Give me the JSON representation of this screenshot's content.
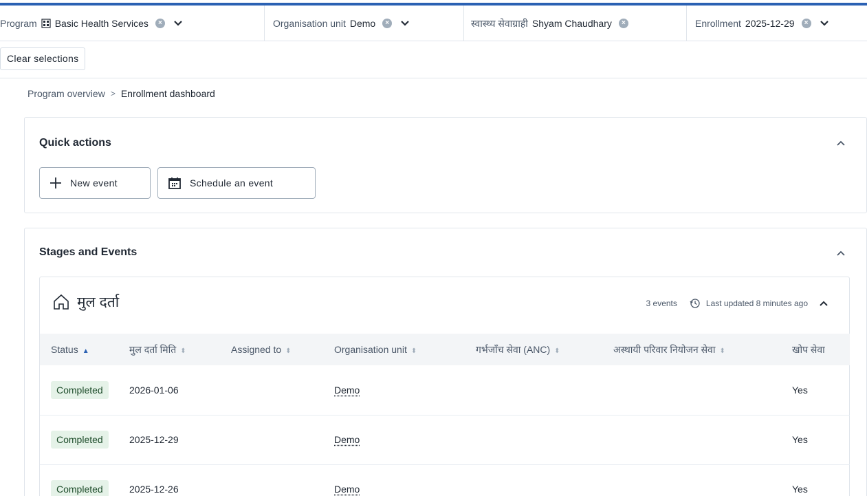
{
  "selection_bar": {
    "program_label": "Program",
    "program_value": "Basic Health Services",
    "orgunit_label": "Organisation unit",
    "orgunit_value": "Demo",
    "person_label": "स्वास्थ्य सेवाग्राही",
    "person_value": "Shyam Chaudhary",
    "enrollment_label": "Enrollment",
    "enrollment_value": "2025-12-29",
    "clear_label": "Clear selections"
  },
  "breadcrumb": {
    "parent": "Program overview",
    "separator": ">",
    "current": "Enrollment dashboard"
  },
  "quick_actions": {
    "title": "Quick actions",
    "new_event_label": "New event",
    "schedule_label": "Schedule an event"
  },
  "stages": {
    "title": "Stages and Events",
    "stage_name": "मुल दर्ता",
    "events_count": "3 events",
    "last_updated": "Last updated 8 minutes ago",
    "columns": [
      "Status",
      "मुल दर्ता मिति",
      "Assigned to",
      "Organisation unit",
      "गर्भजाँच सेवा (ANC)",
      "अस्थायी परिवार नियोजन सेवा",
      "खोप सेवा"
    ],
    "rows": [
      {
        "status": "Completed",
        "date": "2026-01-06",
        "assigned": "",
        "orgunit": "Demo",
        "anc": "",
        "family": "",
        "vaccine": "Yes"
      },
      {
        "status": "Completed",
        "date": "2025-12-29",
        "assigned": "",
        "orgunit": "Demo",
        "anc": "",
        "family": "",
        "vaccine": "Yes"
      },
      {
        "status": "Completed",
        "date": "2025-12-26",
        "assigned": "",
        "orgunit": "Demo",
        "anc": "",
        "family": "",
        "vaccine": "Yes"
      }
    ]
  },
  "colors": {
    "accent": "#2b61b3",
    "badge_bg": "#e5f2e8",
    "badge_text": "#1e4d2b"
  }
}
